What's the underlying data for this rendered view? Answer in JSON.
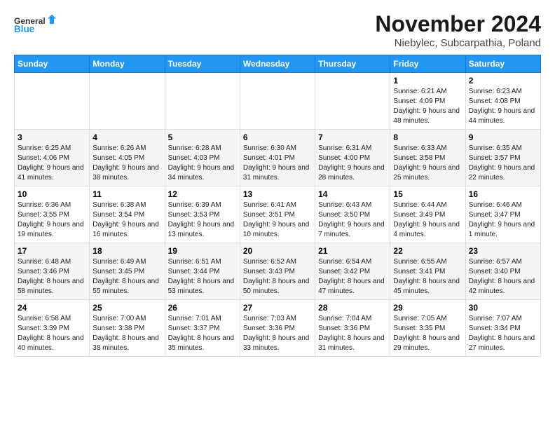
{
  "header": {
    "logo_line1": "General",
    "logo_line2": "Blue",
    "month": "November 2024",
    "location": "Niebylec, Subcarpathia, Poland"
  },
  "days_of_week": [
    "Sunday",
    "Monday",
    "Tuesday",
    "Wednesday",
    "Thursday",
    "Friday",
    "Saturday"
  ],
  "weeks": [
    [
      {
        "day": "",
        "info": ""
      },
      {
        "day": "",
        "info": ""
      },
      {
        "day": "",
        "info": ""
      },
      {
        "day": "",
        "info": ""
      },
      {
        "day": "",
        "info": ""
      },
      {
        "day": "1",
        "info": "Sunrise: 6:21 AM\nSunset: 4:09 PM\nDaylight: 9 hours and 48 minutes."
      },
      {
        "day": "2",
        "info": "Sunrise: 6:23 AM\nSunset: 4:08 PM\nDaylight: 9 hours and 44 minutes."
      }
    ],
    [
      {
        "day": "3",
        "info": "Sunrise: 6:25 AM\nSunset: 4:06 PM\nDaylight: 9 hours and 41 minutes."
      },
      {
        "day": "4",
        "info": "Sunrise: 6:26 AM\nSunset: 4:05 PM\nDaylight: 9 hours and 38 minutes."
      },
      {
        "day": "5",
        "info": "Sunrise: 6:28 AM\nSunset: 4:03 PM\nDaylight: 9 hours and 34 minutes."
      },
      {
        "day": "6",
        "info": "Sunrise: 6:30 AM\nSunset: 4:01 PM\nDaylight: 9 hours and 31 minutes."
      },
      {
        "day": "7",
        "info": "Sunrise: 6:31 AM\nSunset: 4:00 PM\nDaylight: 9 hours and 28 minutes."
      },
      {
        "day": "8",
        "info": "Sunrise: 6:33 AM\nSunset: 3:58 PM\nDaylight: 9 hours and 25 minutes."
      },
      {
        "day": "9",
        "info": "Sunrise: 6:35 AM\nSunset: 3:57 PM\nDaylight: 9 hours and 22 minutes."
      }
    ],
    [
      {
        "day": "10",
        "info": "Sunrise: 6:36 AM\nSunset: 3:55 PM\nDaylight: 9 hours and 19 minutes."
      },
      {
        "day": "11",
        "info": "Sunrise: 6:38 AM\nSunset: 3:54 PM\nDaylight: 9 hours and 16 minutes."
      },
      {
        "day": "12",
        "info": "Sunrise: 6:39 AM\nSunset: 3:53 PM\nDaylight: 9 hours and 13 minutes."
      },
      {
        "day": "13",
        "info": "Sunrise: 6:41 AM\nSunset: 3:51 PM\nDaylight: 9 hours and 10 minutes."
      },
      {
        "day": "14",
        "info": "Sunrise: 6:43 AM\nSunset: 3:50 PM\nDaylight: 9 hours and 7 minutes."
      },
      {
        "day": "15",
        "info": "Sunrise: 6:44 AM\nSunset: 3:49 PM\nDaylight: 9 hours and 4 minutes."
      },
      {
        "day": "16",
        "info": "Sunrise: 6:46 AM\nSunset: 3:47 PM\nDaylight: 9 hours and 1 minute."
      }
    ],
    [
      {
        "day": "17",
        "info": "Sunrise: 6:48 AM\nSunset: 3:46 PM\nDaylight: 8 hours and 58 minutes."
      },
      {
        "day": "18",
        "info": "Sunrise: 6:49 AM\nSunset: 3:45 PM\nDaylight: 8 hours and 55 minutes."
      },
      {
        "day": "19",
        "info": "Sunrise: 6:51 AM\nSunset: 3:44 PM\nDaylight: 8 hours and 53 minutes."
      },
      {
        "day": "20",
        "info": "Sunrise: 6:52 AM\nSunset: 3:43 PM\nDaylight: 8 hours and 50 minutes."
      },
      {
        "day": "21",
        "info": "Sunrise: 6:54 AM\nSunset: 3:42 PM\nDaylight: 8 hours and 47 minutes."
      },
      {
        "day": "22",
        "info": "Sunrise: 6:55 AM\nSunset: 3:41 PM\nDaylight: 8 hours and 45 minutes."
      },
      {
        "day": "23",
        "info": "Sunrise: 6:57 AM\nSunset: 3:40 PM\nDaylight: 8 hours and 42 minutes."
      }
    ],
    [
      {
        "day": "24",
        "info": "Sunrise: 6:58 AM\nSunset: 3:39 PM\nDaylight: 8 hours and 40 minutes."
      },
      {
        "day": "25",
        "info": "Sunrise: 7:00 AM\nSunset: 3:38 PM\nDaylight: 8 hours and 38 minutes."
      },
      {
        "day": "26",
        "info": "Sunrise: 7:01 AM\nSunset: 3:37 PM\nDaylight: 8 hours and 35 minutes."
      },
      {
        "day": "27",
        "info": "Sunrise: 7:03 AM\nSunset: 3:36 PM\nDaylight: 8 hours and 33 minutes."
      },
      {
        "day": "28",
        "info": "Sunrise: 7:04 AM\nSunset: 3:36 PM\nDaylight: 8 hours and 31 minutes."
      },
      {
        "day": "29",
        "info": "Sunrise: 7:05 AM\nSunset: 3:35 PM\nDaylight: 8 hours and 29 minutes."
      },
      {
        "day": "30",
        "info": "Sunrise: 7:07 AM\nSunset: 3:34 PM\nDaylight: 8 hours and 27 minutes."
      }
    ]
  ]
}
